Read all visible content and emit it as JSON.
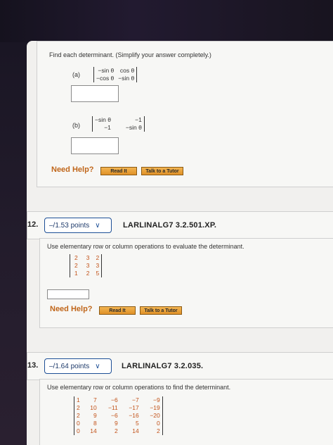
{
  "q11": {
    "instruction": "Find each determinant. (Simplify your answer completely.)",
    "part_a": {
      "label": "(a)",
      "matrix": [
        [
          "−sin θ",
          "cos θ"
        ],
        [
          "−cos θ",
          "−sin θ"
        ]
      ],
      "answer": ""
    },
    "part_b": {
      "label": "(b)",
      "matrix": [
        [
          "−sin θ",
          "−1"
        ],
        [
          "−1",
          "−sin θ"
        ]
      ],
      "answer": ""
    },
    "need_help": "Need Help?",
    "read_it": "Read It",
    "talk_tutor": "Talk to a Tutor"
  },
  "q12": {
    "number": "12.",
    "points": "–/1.53 points",
    "id": "LARLINALG7 3.2.501.XP.",
    "instruction": "Use elementary row or column operations to evaluate the determinant.",
    "matrix": [
      [
        "2",
        "3",
        "2"
      ],
      [
        "2",
        "3",
        "3"
      ],
      [
        "1",
        "2",
        "5"
      ]
    ],
    "answer": "",
    "need_help": "Need Help?",
    "read_it": "Read It",
    "talk_tutor": "Talk to a Tutor"
  },
  "q13": {
    "number": "13.",
    "points": "–/1.64 points",
    "id": "LARLINALG7 3.2.035.",
    "instruction": "Use elementary row or column operations to find the determinant.",
    "matrix": [
      [
        "1",
        "7",
        "−6",
        "−7",
        "−9"
      ],
      [
        "2",
        "10",
        "−11",
        "−17",
        "−19"
      ],
      [
        "2",
        "9",
        "−6",
        "−16",
        "−20"
      ],
      [
        "0",
        "8",
        "9",
        "5",
        "0"
      ],
      [
        "0",
        "14",
        "2",
        "14",
        "2"
      ]
    ]
  },
  "colors": {
    "accent_blue": "#1d4f96",
    "need_help_orange": "#c0661a",
    "button_orange": "#e8a33c",
    "matrix_orange": "#c2531a"
  }
}
